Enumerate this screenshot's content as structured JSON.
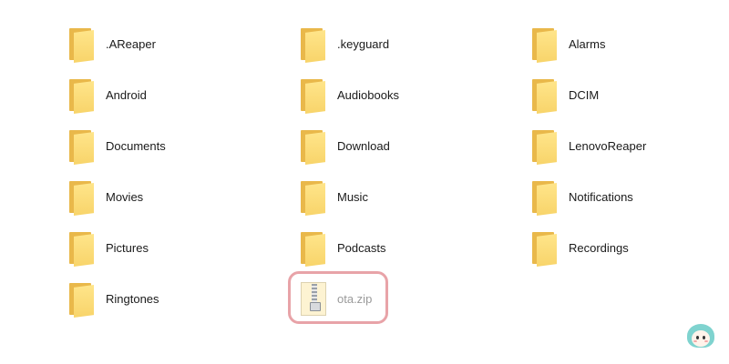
{
  "folders": [
    {
      "label": ".AReaper"
    },
    {
      "label": ".keyguard"
    },
    {
      "label": "Alarms"
    },
    {
      "label": "Android"
    },
    {
      "label": "Audiobooks"
    },
    {
      "label": "DCIM"
    },
    {
      "label": "Documents"
    },
    {
      "label": "Download"
    },
    {
      "label": "LenovoReaper"
    },
    {
      "label": "Movies"
    },
    {
      "label": "Music"
    },
    {
      "label": "Notifications"
    },
    {
      "label": "Pictures"
    },
    {
      "label": "Podcasts"
    },
    {
      "label": "Recordings"
    },
    {
      "label": "Ringtones"
    }
  ],
  "file": {
    "label": "ota.zip",
    "icon": "zip-archive-icon"
  },
  "colors": {
    "folder_front": "#f8d46a",
    "folder_back": "#e9b84a",
    "highlight_border": "#e8a3a8",
    "label_text": "#1a1a1a",
    "dim_text": "#9a9a9a"
  }
}
